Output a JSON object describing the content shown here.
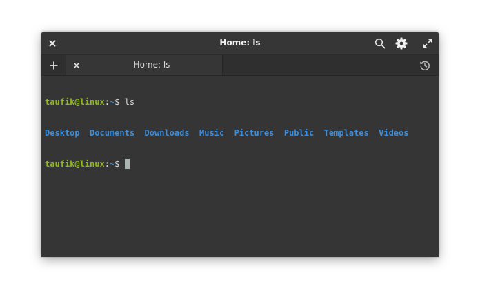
{
  "window": {
    "title": "Home: ls"
  },
  "tabs": [
    {
      "label": "Home: ls"
    }
  ],
  "terminal": {
    "prompt_user_host": "taufik@linux",
    "prompt_separator": ":",
    "prompt_path": "~",
    "prompt_symbol": "$ ",
    "command": "ls",
    "directories": [
      "Desktop",
      "Documents",
      "Downloads",
      "Music",
      "Pictures",
      "Public",
      "Templates",
      "Videos"
    ]
  },
  "icons": {
    "close": "close-icon",
    "search": "search-icon",
    "settings": "gear-icon",
    "maximize": "maximize-icon",
    "new_tab": "plus-icon",
    "tab_close": "close-icon",
    "history": "history-icon"
  },
  "colors": {
    "background": "#353535",
    "prompt_user": "#8fba16",
    "prompt_path": "#2f91e0",
    "directory": "#3a8ee0",
    "cursor": "#a8b5b0"
  }
}
